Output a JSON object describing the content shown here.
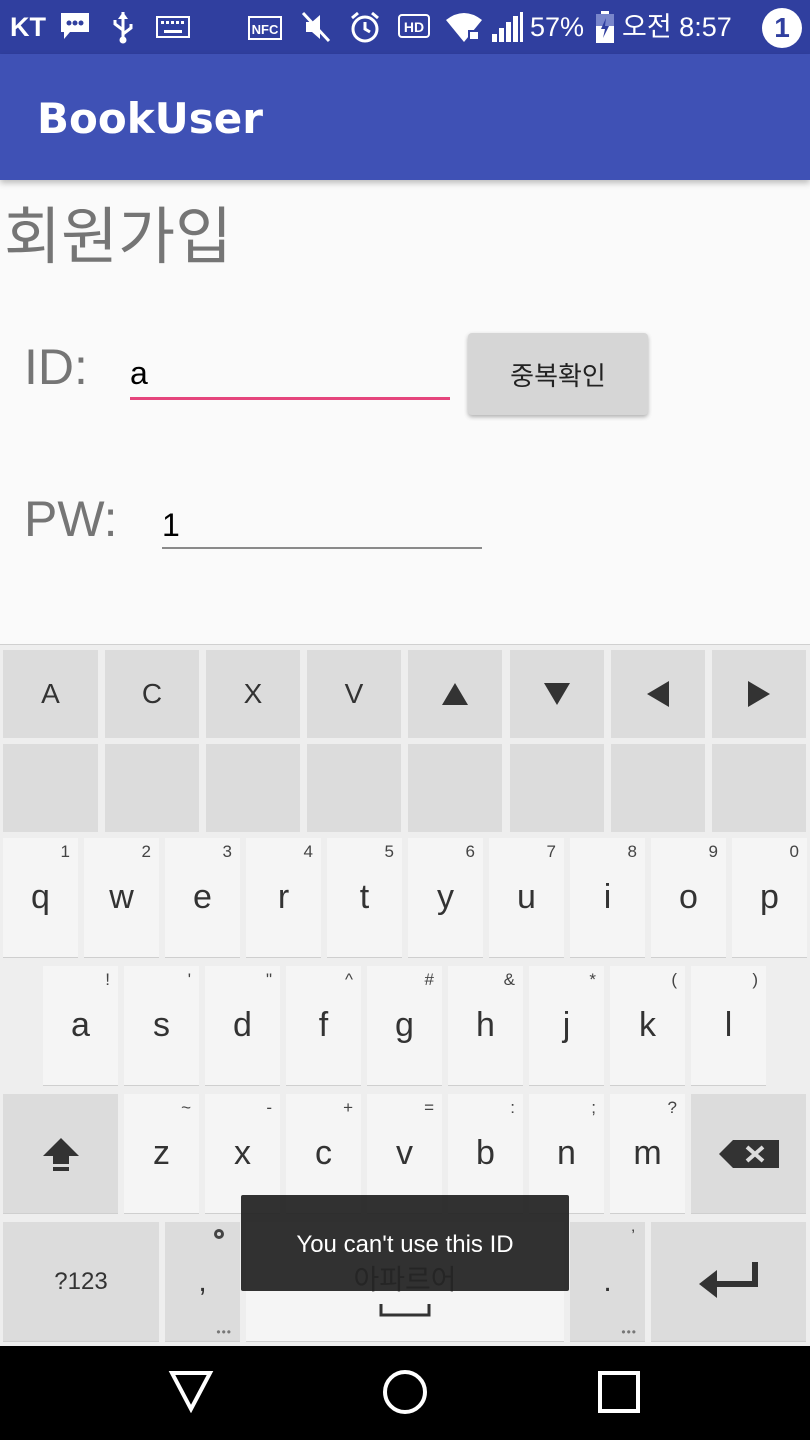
{
  "status_bar": {
    "carrier": "KT",
    "battery": "57%",
    "time": "오전 8:57",
    "notification_count": "1",
    "nfc": "NFC",
    "hd": "HD",
    "icons": [
      "chat-icon",
      "usb-icon",
      "keyboard-icon",
      "nfc-icon",
      "mute-icon",
      "alarm-icon",
      "hd-icon",
      "wifi-icon",
      "signal-icon",
      "battery-icon"
    ]
  },
  "app_bar": {
    "title": "BookUser"
  },
  "form": {
    "heading": "회원가입",
    "id_label": "ID:",
    "id_value": "a",
    "pw_label": "PW:",
    "pw_value": "1",
    "duplicate_check_label": "중복확인",
    "accent_color": "#e5457c"
  },
  "keyboard": {
    "toolbar": [
      "A",
      "C",
      "X",
      "V"
    ],
    "rows": [
      [
        {
          "k": "q",
          "h": "1"
        },
        {
          "k": "w",
          "h": "2"
        },
        {
          "k": "e",
          "h": "3"
        },
        {
          "k": "r",
          "h": "4"
        },
        {
          "k": "t",
          "h": "5"
        },
        {
          "k": "y",
          "h": "6"
        },
        {
          "k": "u",
          "h": "7"
        },
        {
          "k": "i",
          "h": "8"
        },
        {
          "k": "o",
          "h": "9"
        },
        {
          "k": "p",
          "h": "0"
        }
      ],
      [
        {
          "k": "a",
          "h": "!"
        },
        {
          "k": "s",
          "h": "'"
        },
        {
          "k": "d",
          "h": "\""
        },
        {
          "k": "f",
          "h": "^"
        },
        {
          "k": "g",
          "h": "#"
        },
        {
          "k": "h",
          "h": "&"
        },
        {
          "k": "j",
          "h": "*"
        },
        {
          "k": "k",
          "h": "("
        },
        {
          "k": "l",
          "h": ")"
        }
      ],
      [
        {
          "k": "z",
          "h": "~"
        },
        {
          "k": "x",
          "h": "-"
        },
        {
          "k": "c",
          "h": "+"
        },
        {
          "k": "v",
          "h": "="
        },
        {
          "k": "b",
          "h": ":"
        },
        {
          "k": "n",
          "h": ";"
        },
        {
          "k": "m",
          "h": "?"
        }
      ]
    ],
    "symbols_key": "?123",
    "comma_key": ",",
    "period_key": ".",
    "period_hint": "’",
    "space_language": "아파르어"
  },
  "toast": {
    "message": "You can't use this ID"
  }
}
